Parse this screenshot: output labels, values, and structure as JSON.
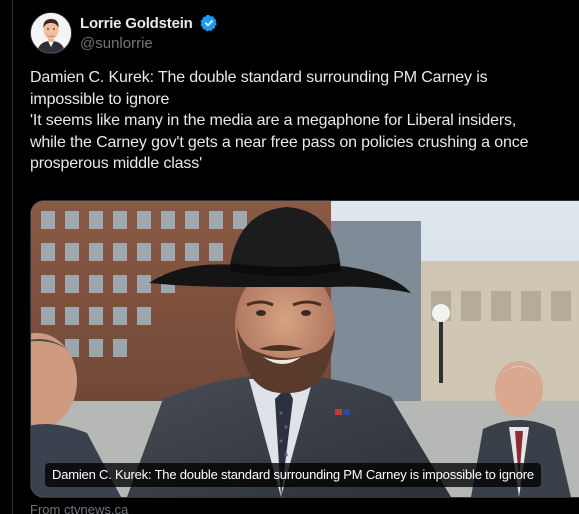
{
  "author": {
    "display_name": "Lorrie Goldstein",
    "handle": "@sunlorrie",
    "verified": true
  },
  "tweet": {
    "lines": [
      "Damien C. Kurek: The double standard surrounding PM Carney is",
      "impossible to ignore",
      "'It seems like many in the media are a megaphone for Liberal insiders,",
      "while the Carney gov't gets a near free pass on policies crushing a once",
      "prosperous middle class'"
    ]
  },
  "card": {
    "caption": "Damien C. Kurek: The double standard surrounding PM Carney is impossible to ignore",
    "source": "From ctvnews.ca"
  },
  "colors": {
    "background": "#000000",
    "text": "#e7e9ea",
    "secondary": "#71767b",
    "verified_badge": "#1d9bf0",
    "border": "#2f3336"
  },
  "icons": {
    "verified": "verified-badge-icon"
  }
}
